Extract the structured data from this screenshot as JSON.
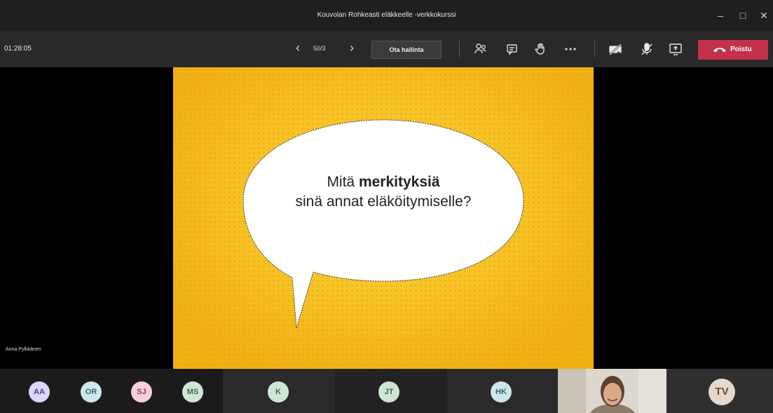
{
  "window": {
    "title": "Kouvolan Rohkeasti eläkkeelle -verkkokurssi",
    "minimize_icon": "minimize-icon",
    "maximize_icon": "maximize-icon",
    "close_icon": "close-icon"
  },
  "toolbar": {
    "timer": "01:28:05",
    "slide_counter": "50/3",
    "take_control_label": "Ota hallinta",
    "leave_label": "Poistu",
    "leave_color": "#c4314b",
    "icons": [
      "people-icon",
      "chat-icon",
      "raise-hand-icon",
      "more-icon",
      "camera-off-icon",
      "mic-off-icon",
      "share-screen-icon",
      "phone-icon"
    ]
  },
  "slide": {
    "line1_normal": "Mitä ",
    "line1_bold": "merkityksiä",
    "line2": "sinä annat eläköitymiselle?",
    "background_color": "#f4c21d"
  },
  "stage": {
    "presenter_name": "Anna Pylkkänen"
  },
  "participants": [
    {
      "initials": "AA",
      "bg": "#dcd6f7",
      "fg": "#4a3f8c"
    },
    {
      "initials": "OR",
      "bg": "#cfe7ec",
      "fg": "#2f6b78"
    },
    {
      "initials": "SJ",
      "bg": "#f6d0de",
      "fg": "#9b3b5e"
    },
    {
      "initials": "MS",
      "bg": "#cfe6d6",
      "fg": "#36704a"
    },
    {
      "initials": "K",
      "bg": "#cfe6d6",
      "fg": "#36704a"
    },
    {
      "initials": "JT",
      "bg": "#cfe6d6",
      "fg": "#36704a"
    },
    {
      "initials": "HK",
      "bg": "#cfe7ec",
      "fg": "#2f6b78"
    },
    {
      "initials": "TV",
      "bg": "#e5d8cc",
      "fg": "#6b4a30"
    }
  ]
}
